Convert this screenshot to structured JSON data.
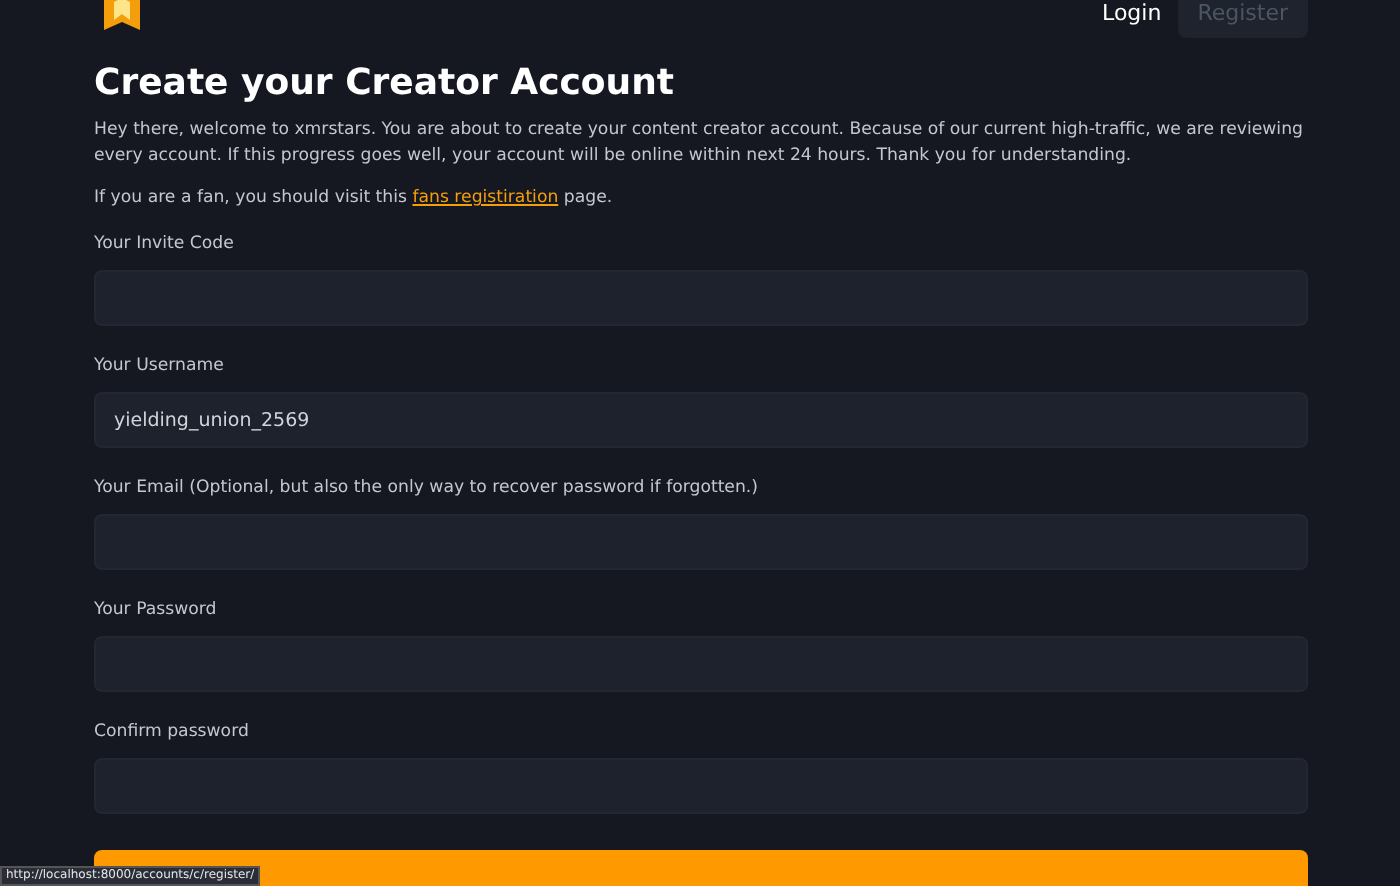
{
  "nav": {
    "login": "Login",
    "register": "Register"
  },
  "title": "Create your Creator Account",
  "intro": "Hey there, welcome to xmrstars. You are about to create your content creator account. Because of our current high-traffic, we are reviewing every account. If this progress goes well, your account will be online within next 24 hours. Thank you for understanding.",
  "fan_note": {
    "before": "If you are a fan, you should visit this",
    "link": "fans registiration",
    "after": "page."
  },
  "fields": [
    {
      "label": "Your Invite Code"
    },
    {
      "label": "Your Username",
      "value": "yielding_union_2569"
    },
    {
      "label": "Your Email (Optional, but also the only way to recover password if forgotten.)"
    },
    {
      "label": "Your Password"
    },
    {
      "label": "Confirm password"
    }
  ],
  "status_url": "http://localhost:8000/accounts/c/register/"
}
